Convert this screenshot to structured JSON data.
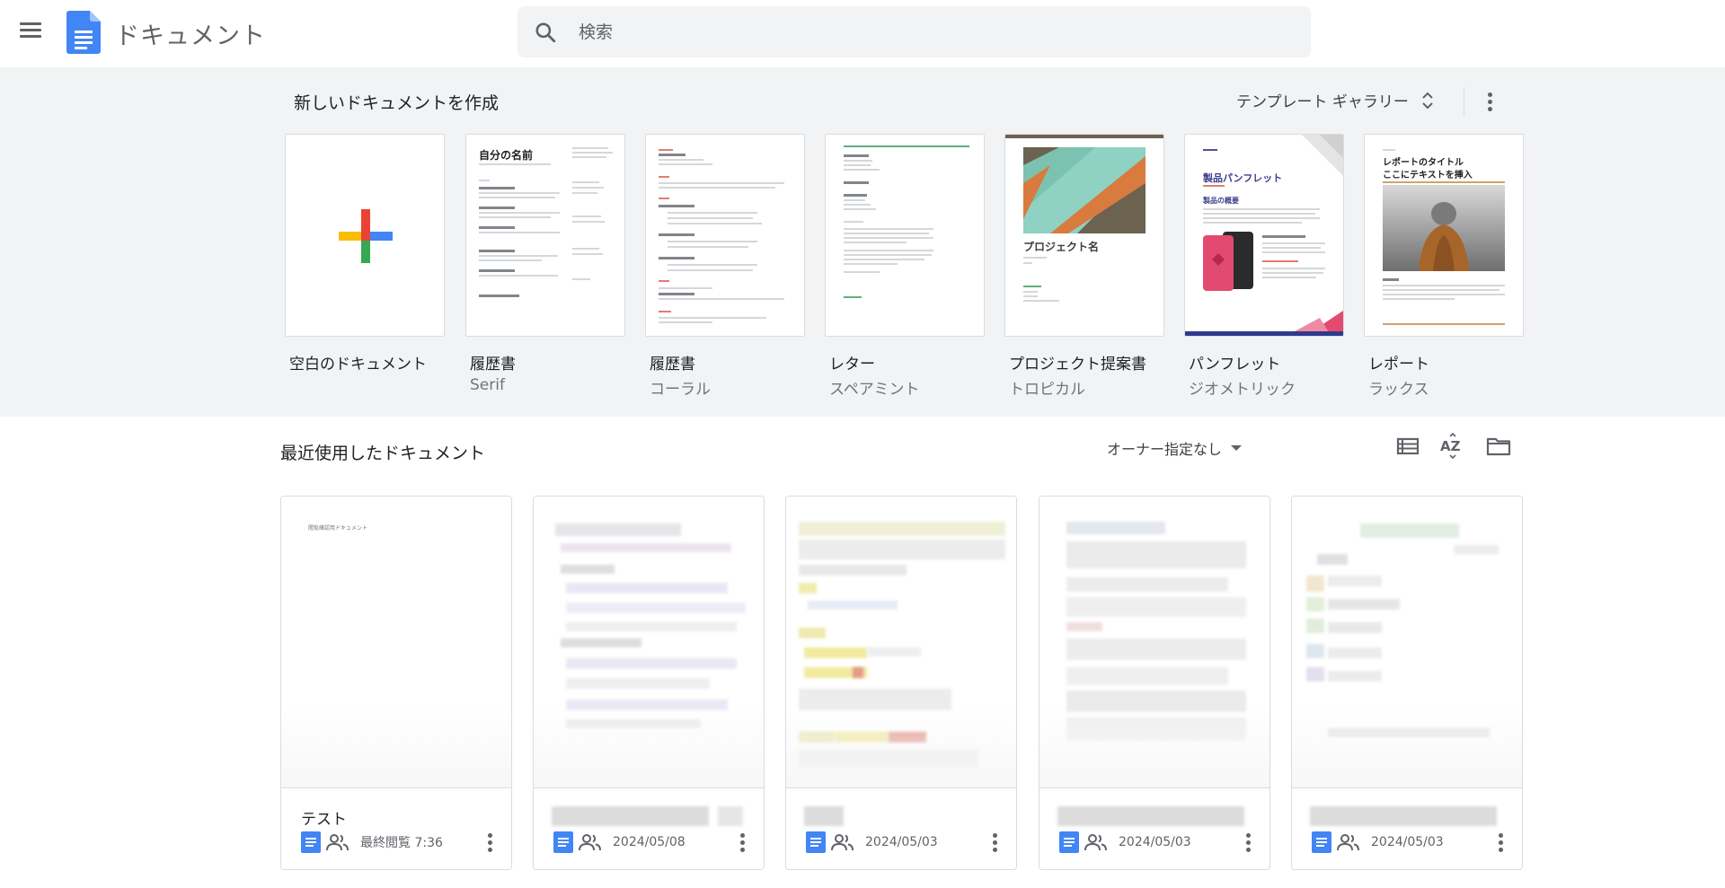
{
  "header": {
    "app_title": "ドキュメント",
    "search_placeholder": "検索"
  },
  "gallery": {
    "title": "新しいドキュメントを作成",
    "toggle_label": "テンプレート ギャラリー",
    "templates": [
      {
        "name": "空白のドキュメント",
        "sub": ""
      },
      {
        "name": "履歴書",
        "sub": "Serif",
        "preview_title": "自分の名前"
      },
      {
        "name": "履歴書",
        "sub": "コーラル"
      },
      {
        "name": "レター",
        "sub": "スペアミント"
      },
      {
        "name": "プロジェクト提案書",
        "sub": "トロピカル",
        "preview_title": "プロジェクト名"
      },
      {
        "name": "パンフレット",
        "sub": "ジオメトリック",
        "preview_title": "製品パンフレット",
        "preview_sub": "製品の概要"
      },
      {
        "name": "レポート",
        "sub": "ラックス",
        "preview_title": "レポートのタイトル",
        "preview_title2": "ここにテキストを挿入"
      }
    ]
  },
  "recent": {
    "title": "最近使用したドキュメント",
    "owner_filter": "オーナー指定なし",
    "docs": [
      {
        "name": "テスト",
        "date": "最終閲覧 7:36",
        "preview_text": "閲覧確認用ドキュメント"
      },
      {
        "name": "",
        "date": "2024/05/08"
      },
      {
        "name": "",
        "date": "2024/05/03"
      },
      {
        "name": "",
        "date": "2024/05/03"
      },
      {
        "name": "",
        "date": "2024/05/03"
      }
    ]
  },
  "colors": {
    "docs_blue": "#4285f4",
    "gallery_bg": "#f1f3f4"
  }
}
